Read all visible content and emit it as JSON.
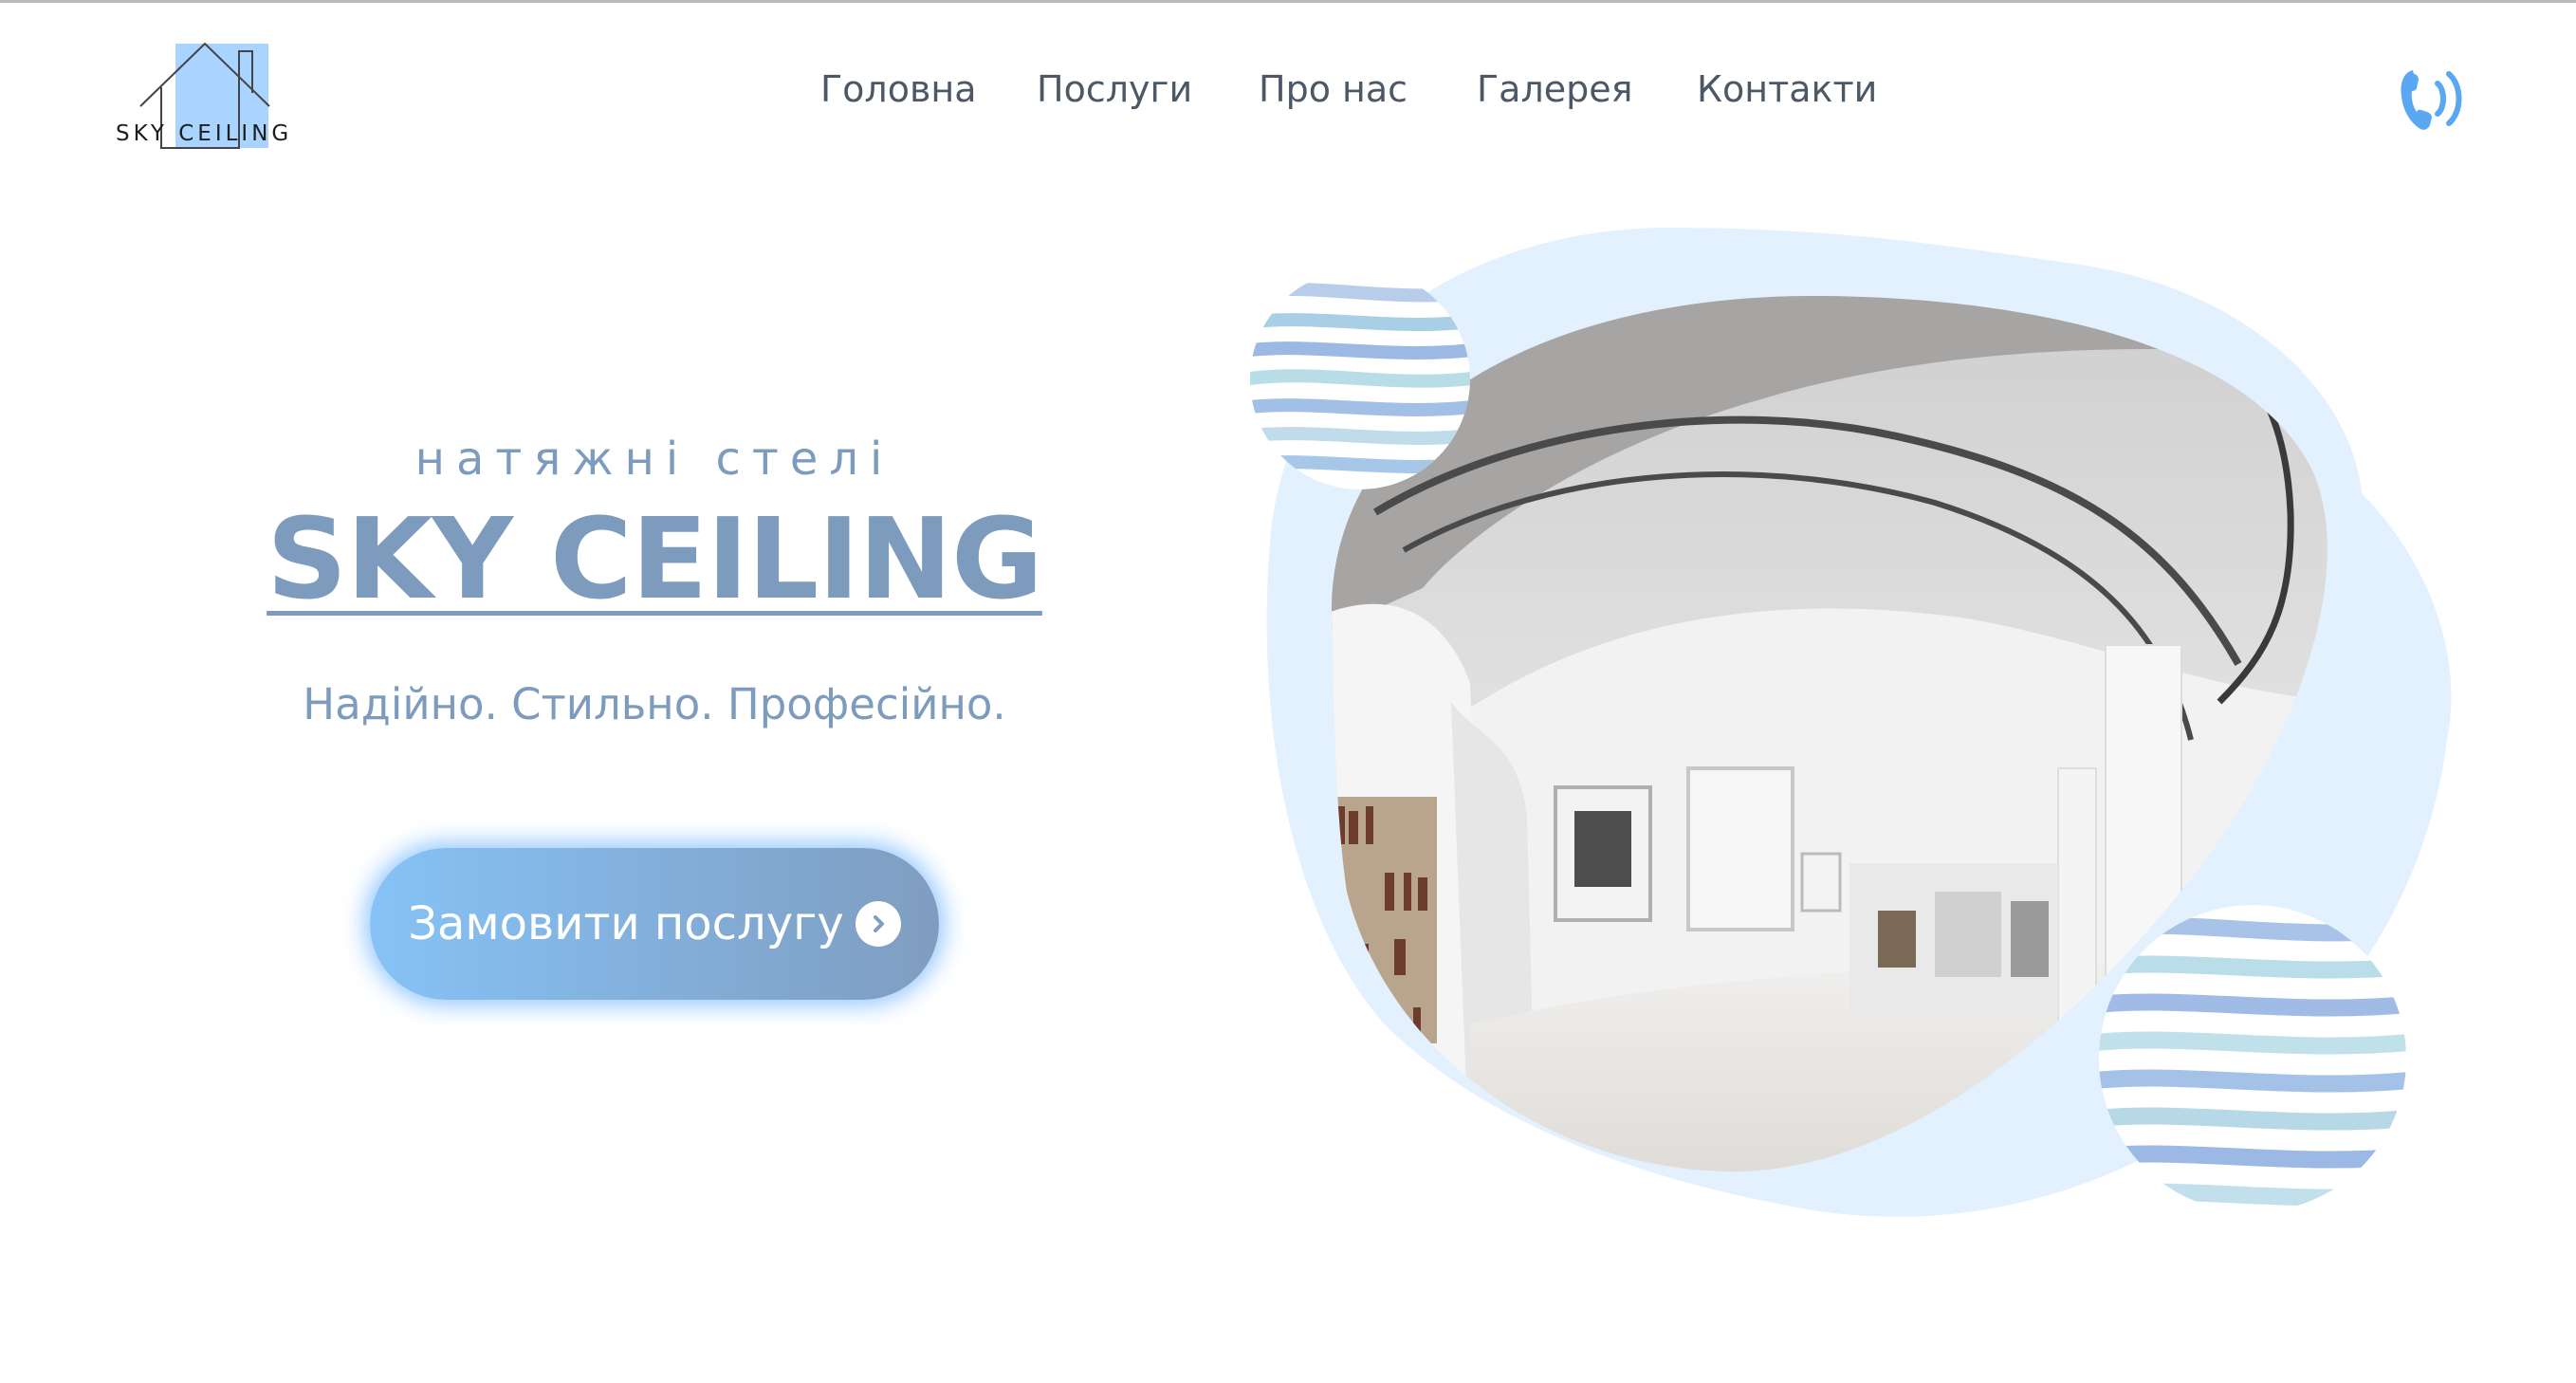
{
  "header": {
    "logo_text": "SKY CEILING",
    "nav": [
      {
        "label": "Головна"
      },
      {
        "label": "Послуги"
      },
      {
        "label": "Про нас"
      },
      {
        "label": "Галерея"
      },
      {
        "label": "Контакти"
      }
    ],
    "phone_icon": "phone-icon"
  },
  "hero": {
    "subtitle": "натяжні стелі",
    "title": "SKY CEILING",
    "tagline": "Надійно. Стильно. Професійно.",
    "cta_label": "Замовити послугу",
    "cta_icon": "chevron-right-circle-icon",
    "image": "ceiling-gallery-photo"
  },
  "colors": {
    "accent": "#7d9cbd",
    "nav_text": "#4c5866",
    "phone": "#5aa8f2",
    "logo_fill": "#a8d4ff",
    "blob": "#e2f1fd"
  }
}
